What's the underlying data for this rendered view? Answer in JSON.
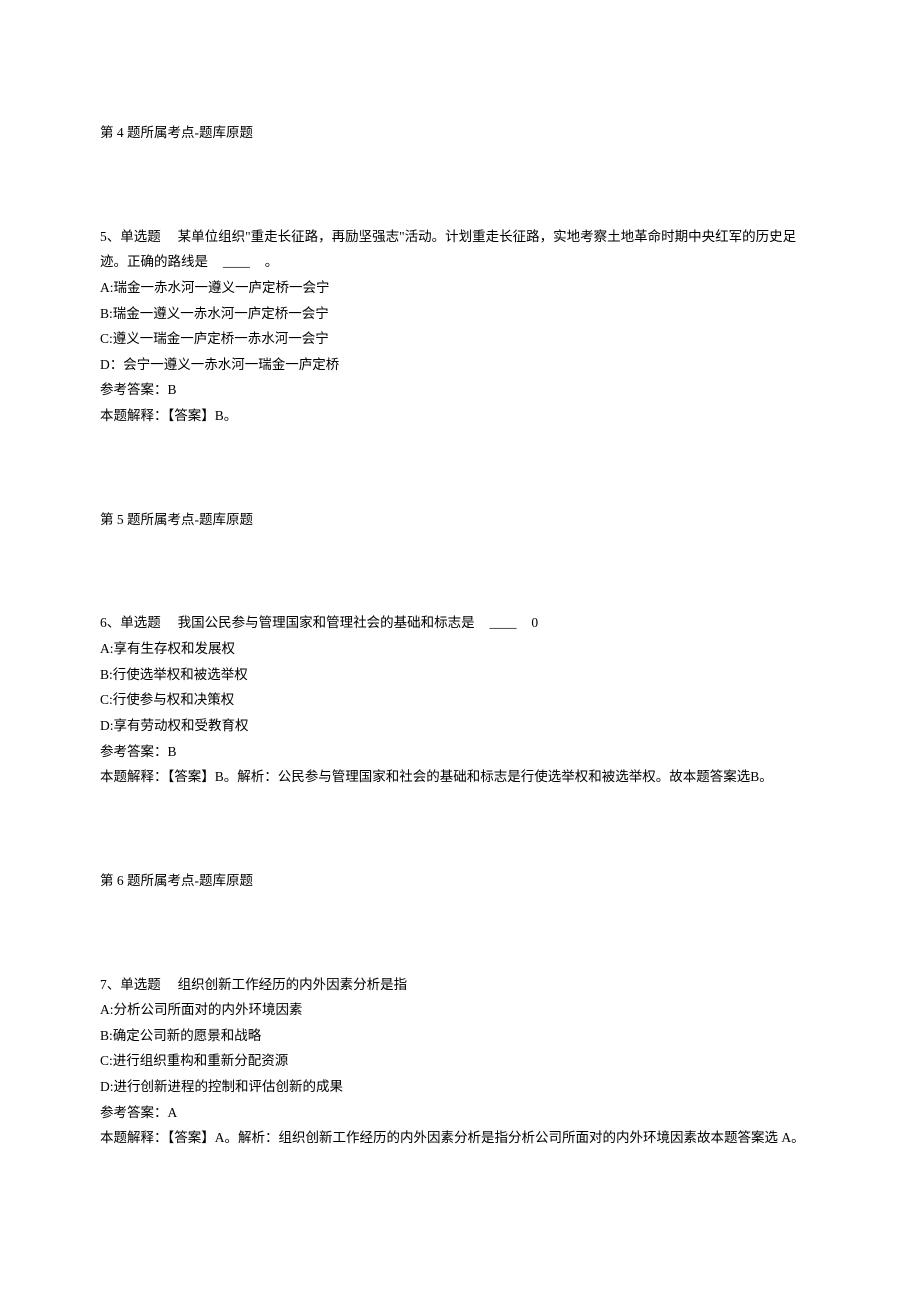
{
  "q4": {
    "tag": "第 4 题所属考点-题库原题"
  },
  "q5": {
    "num": "5、单选题",
    "stem_a": "某单位组织\"重走长征路，再励坚强志\"活动。计划重走长征路，实地考察土地革命时期中央红军的历史足迹。正确的路线是",
    "blank": "____",
    "stem_b": "。",
    "optA": "A:瑞金一赤水河一遵义一庐定桥一会宁",
    "optB": "B:瑞金一遵义一赤水河一庐定桥一会宁",
    "optC": "C:遵义一瑞金一庐定桥一赤水河一会宁",
    "optD": "D：会宁一遵义一赤水河一瑞金一庐定桥",
    "ans": "参考答案：B",
    "explain": "本题解释：【答案】B。",
    "tag": "第 5 题所属考点-题库原题"
  },
  "q6": {
    "num": "6、单选题",
    "stem_a": "我国公民参与管理国家和管理社会的基础和标志是",
    "blank": "____",
    "stem_b": "0",
    "optA": "A:享有生存权和发展权",
    "optB": "B:行使选举权和被选举权",
    "optC": "C:行使参与权和决策权",
    "optD": "D:享有劳动权和受教育权",
    "ans": "参考答案：B",
    "explain": "本题解释：【答案】B。解析：公民参与管理国家和社会的基础和标志是行使选举权和被选举权。故本题答案选B。",
    "tag": "第 6 题所属考点-题库原题"
  },
  "q7": {
    "num": "7、单选题",
    "stem": "组织创新工作经历的内外因素分析是指",
    "optA": "A:分析公司所面对的内外环境因素",
    "optB": "B:确定公司新的愿景和战略",
    "optC": "C:进行组织重构和重新分配资源",
    "optD": "D:进行创新进程的控制和评估创新的成果",
    "ans": "参考答案：A",
    "explain": "本题解释：【答案】A。解析：组织创新工作经历的内外因素分析是指分析公司所面对的内外环境因素故本题答案选 A。"
  }
}
